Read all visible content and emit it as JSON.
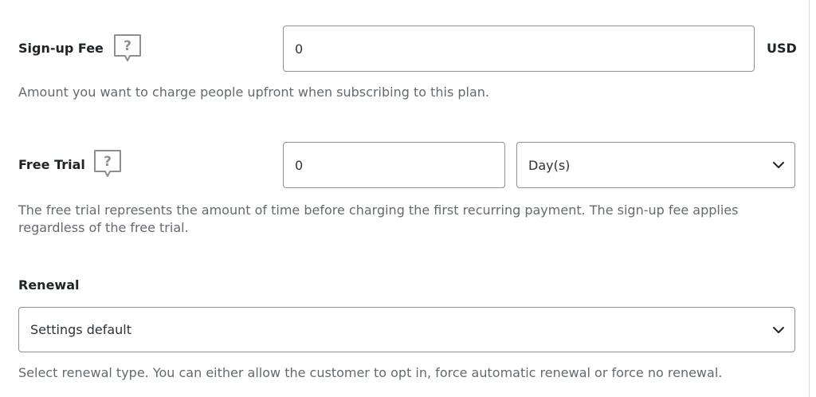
{
  "signup_fee": {
    "label": "Sign-up Fee",
    "help_icon": "question-bubble-icon",
    "value": "0",
    "currency": "USD",
    "description": "Amount you want to charge people upfront when subscribing to this plan."
  },
  "free_trial": {
    "label": "Free Trial",
    "help_icon": "question-bubble-icon",
    "value": "0",
    "unit_selected": "Day(s)",
    "description": "The free trial represents the amount of time before charging the first recurring payment. The sign-up fee applies regardless of the free trial."
  },
  "renewal": {
    "label": "Renewal",
    "selected": "Settings default",
    "description": "Select renewal type. You can either allow the customer to opt in, force automatic renewal or force no renewal."
  },
  "colors": {
    "text": "#1d2327",
    "muted_text": "#646970",
    "border": "#8c8f94",
    "icon": "#8c8f94"
  }
}
